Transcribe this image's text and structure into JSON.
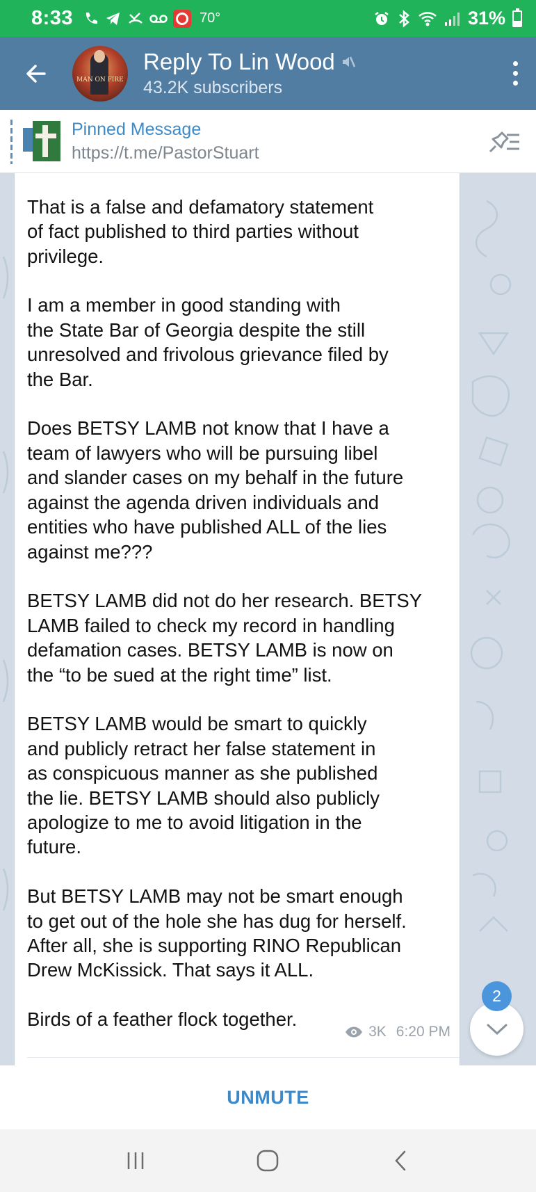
{
  "status_bar": {
    "time": "8:33",
    "temperature": "70°",
    "battery_percent": "31%",
    "battery_level": 0.31,
    "icons": [
      "wifi-calling-icon",
      "telegram-icon",
      "missed-call-icon",
      "voicemail-icon",
      "weather-app-icon",
      "alarm-icon",
      "bluetooth-icon",
      "wifi-icon",
      "signal-icon",
      "battery-icon"
    ]
  },
  "header": {
    "title": "Reply To Lin Wood",
    "subscribers": "43.2K subscribers",
    "avatar_text": "MAN ON FIRE",
    "muted": true
  },
  "pinned": {
    "title": "Pinned Message",
    "url": "https://t.me/PastorStuart"
  },
  "message": {
    "text": "Georgia.\n\nThat is a false and defamatory statement\nof fact published to third parties without\nprivilege.\n\nI am a member in good standing with\nthe State Bar of Georgia despite the still\nunresolved and frivolous grievance filed by\nthe Bar.\n\nDoes BETSY LAMB not know that I have a\nteam of lawyers who will be pursuing libel\nand slander cases on my behalf in the future\nagainst the agenda driven individuals and\nentities who have published ALL of the lies\nagainst me???\n\nBETSY LAMB did not do her research. BETSY\nLAMB failed to check my record in handling\ndefamation cases. BETSY LAMB is now on\nthe “to be sued at the right time” list.\n\nBETSY LAMB would be smart to quickly\nand publicly retract her false statement in\nas conspicuous manner as she published\nthe lie. BETSY LAMB should also publicly\napologize to me to avoid litigation in the\nfuture.\n\nBut BETSY LAMB may not be smart enough\nto get out of the hole she has dug for herself.\nAfter all, she is supporting RINO Republican\nDrew McKissick. That says it ALL.\n\nBirds of a feather flock together.",
    "views": "3K",
    "time": "6:20 PM"
  },
  "scroll_badge": "2",
  "bottom_bar": {
    "unmute_label": "UNMUTE"
  },
  "nav": {
    "buttons": [
      "recent-apps",
      "home",
      "back"
    ]
  },
  "colors": {
    "status_bar": "#21b35a",
    "header": "#527da3",
    "accent": "#3d88c7",
    "badge": "#4a95dc",
    "wallpaper": "#d3dce6"
  }
}
